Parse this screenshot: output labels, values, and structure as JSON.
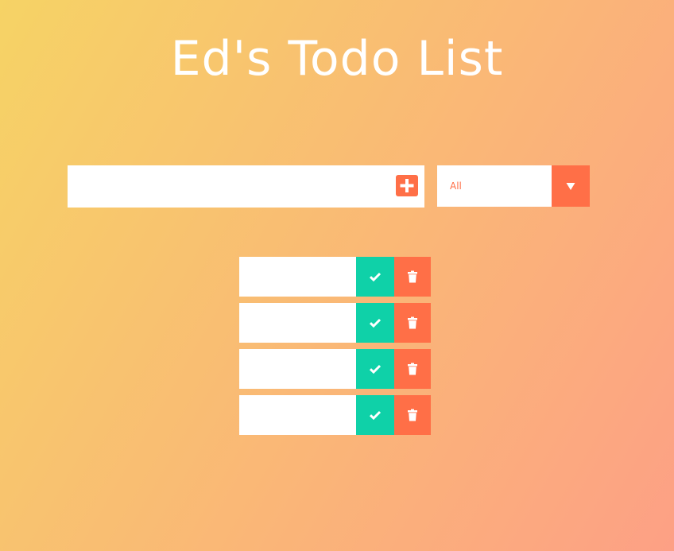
{
  "header": {
    "title": "Ed's Todo List"
  },
  "form": {
    "input_value": "",
    "add_icon": "plus-square-icon",
    "filter_selected": "All",
    "filter_arrow_icon": "caret-down-icon"
  },
  "todos": [
    {
      "text": "",
      "complete_icon": "check-icon",
      "delete_icon": "trash-icon"
    },
    {
      "text": "",
      "complete_icon": "check-icon",
      "delete_icon": "trash-icon"
    },
    {
      "text": "",
      "complete_icon": "check-icon",
      "delete_icon": "trash-icon"
    },
    {
      "text": "",
      "complete_icon": "check-icon",
      "delete_icon": "trash-icon"
    }
  ],
  "colors": {
    "gradient_start": "#f6d365",
    "gradient_end": "#fda085",
    "accent": "#ff6f47",
    "complete": "#0fd1a8",
    "surface": "#ffffff"
  }
}
